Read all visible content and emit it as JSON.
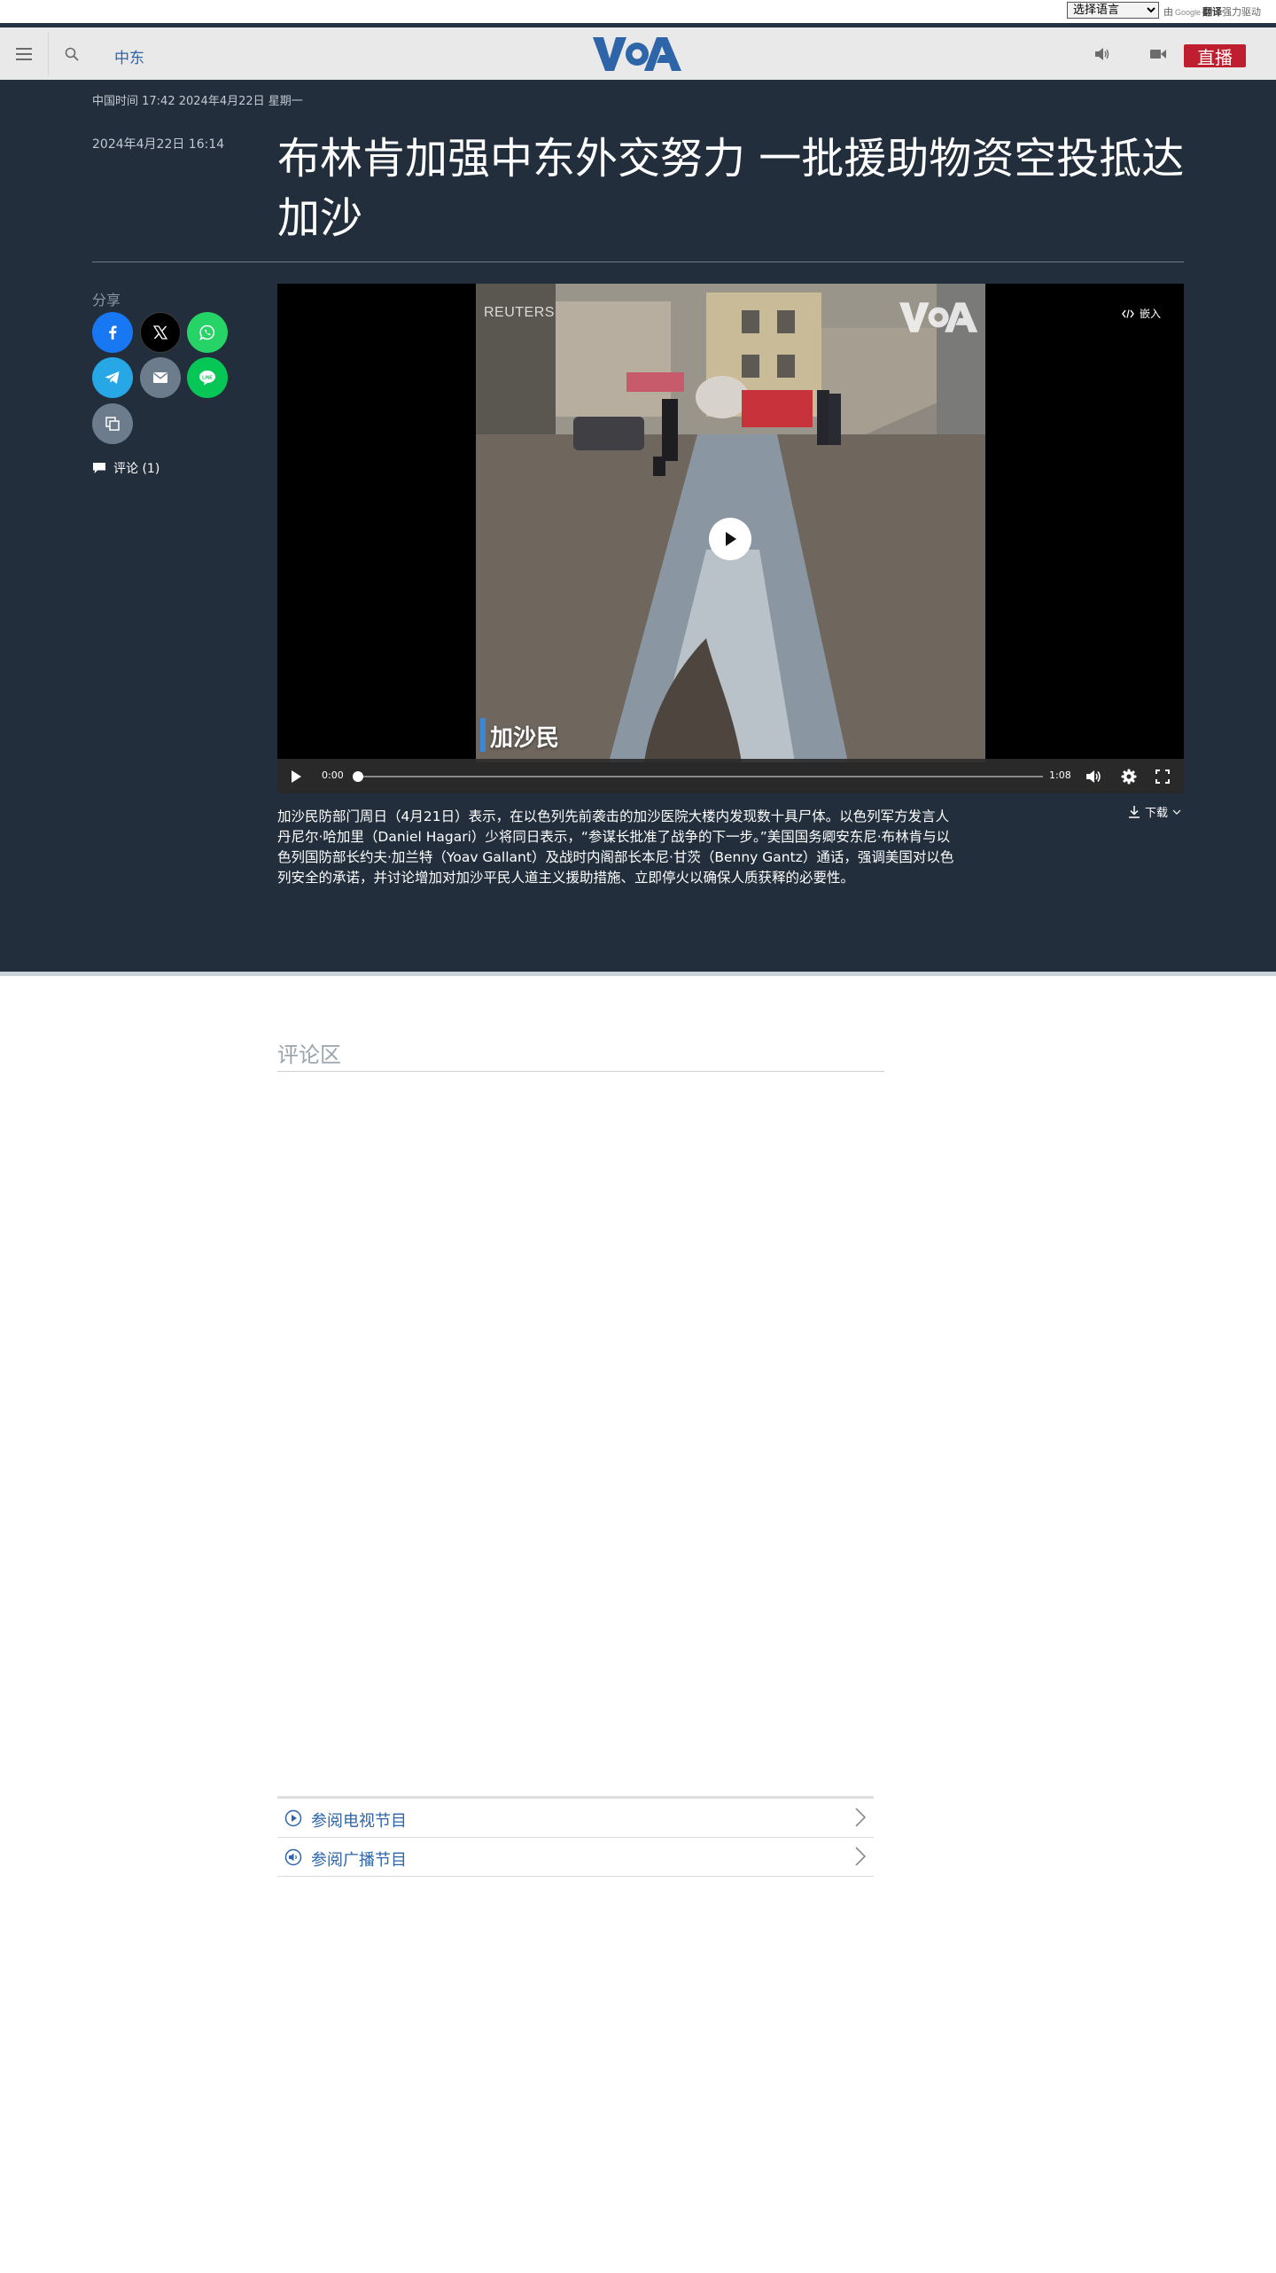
{
  "translate": {
    "select_value": "选择语言",
    "credit_prefix": "由",
    "credit_google": "Google",
    "credit_translate": "翻译",
    "credit_suffix": "强力驱动"
  },
  "header": {
    "section_link": "中东",
    "live_label": "直播",
    "logo_alt": "VOA"
  },
  "article": {
    "current_time": "中国时间 17:42 2024年4月22日 星期一",
    "publish_date": "2024年4月22日 16:14",
    "title": "布林肯加强中东外交努力 一批援助物资空投抵达加沙",
    "share_label": "分享",
    "comments_link": "评论 (1)",
    "share_icons": [
      "facebook-icon",
      "x-icon",
      "whatsapp-icon",
      "telegram-icon",
      "email-icon",
      "line-icon",
      "copy-link-icon"
    ]
  },
  "video": {
    "watermark_source": "REUTERS",
    "caption": "加沙民",
    "embed_label": "嵌入",
    "time_current": "0:00",
    "time_total": "1:08",
    "progress": 0,
    "download_label": "下载",
    "description": "加沙民防部门周日（4月21日）表示，在以色列先前袭击的加沙医院大楼内发现数十具尸体。以色列军方发言人丹尼尔·哈加里（Daniel Hagari）少将同日表示，“参谋长批准了战争的下一步。”美国国务卿安东尼·布林肯与以色列国防部长约夫·加兰特（Yoav Gallant）及战时内阁部长本尼·甘茨（Benny Gantz）通话，强调美国对以色列安全的承诺，并讨论增加对加沙平民人道主义援助措施、立即停火以确保人质获释的必要性。"
  },
  "comments": {
    "heading": "评论区"
  },
  "programs": [
    {
      "label": "参阅电视节目",
      "icon": "play-circle-icon"
    },
    {
      "label": "参阅广播节目",
      "icon": "speaker-circle-icon"
    }
  ],
  "colors": {
    "header_bg": "#e9e9e9",
    "article_bg": "#222e3b",
    "accent_blue": "#2d65a8",
    "live_red": "#be1e2d"
  }
}
